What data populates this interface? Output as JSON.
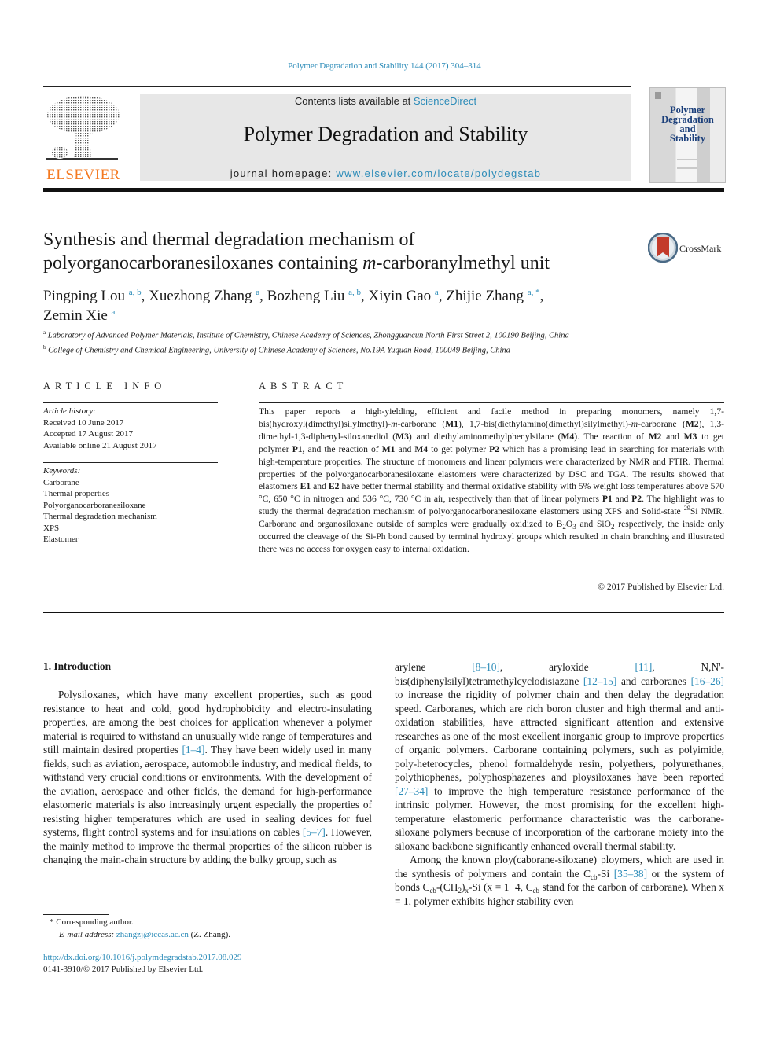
{
  "journal_citation": "Polymer Degradation and Stability 144 (2017) 304–314",
  "header": {
    "publisher_logo_text": "ELSEVIER",
    "contents_prefix": "Contents lists available at ",
    "contents_link": "ScienceDirect",
    "journal_title": "Polymer Degradation and Stability",
    "homepage_prefix": "journal homepage: ",
    "homepage_link": "www.elsevier.com/locate/polydegstab",
    "cover_title_lines": [
      "Polymer",
      "Degradation",
      "and",
      "Stability"
    ],
    "crossmark_label": "CrossMark"
  },
  "article": {
    "title_line1": "Synthesis and thermal degradation mechanism of",
    "title_line2_pre": "polyorganocarboranesiloxanes containing ",
    "title_line2_ital": "m",
    "title_line2_post": "-carboranylmethyl unit",
    "authors": [
      {
        "name": "Pingping Lou",
        "aff": "a, b"
      },
      {
        "name": "Xuezhong Zhang",
        "aff": "a"
      },
      {
        "name": "Bozheng Liu",
        "aff": "a, b"
      },
      {
        "name": "Xiyin Gao",
        "aff": "a"
      },
      {
        "name": "Zhijie Zhang",
        "aff": "a, *"
      },
      {
        "name": "Zemin Xie",
        "aff": "a"
      }
    ],
    "affiliations": [
      {
        "key": "a",
        "text": "Laboratory of Advanced Polymer Materials, Institute of Chemistry, Chinese Academy of Sciences, Zhongguancun North First Street 2, 100190 Beijing, China"
      },
      {
        "key": "b",
        "text": "College of Chemistry and Chemical Engineering, University of Chinese Academy of Sciences, No.19A Yuquan Road, 100049 Beijing, China"
      }
    ]
  },
  "article_info": {
    "heading": "ARTICLE INFO",
    "history_label": "Article history:",
    "history": [
      "Received 10 June 2017",
      "Accepted 17 August 2017",
      "Available online 21 August 2017"
    ],
    "keywords_label": "Keywords:",
    "keywords": [
      "Carborane",
      "Thermal properties",
      "Polyorganocarboranesiloxane",
      "Thermal degradation mechanism",
      "XPS",
      "Elastomer"
    ]
  },
  "abstract": {
    "heading": "ABSTRACT",
    "t1": "This paper reports a high-yielding, efficient and facile method in preparing monomers, namely 1,7-bis(hydroxyl(dimethyl)silylmethyl)-",
    "m": "m",
    "t2": "-carborane (",
    "M1": "M1",
    "t3": "), 1,7-bis(diethylamino(dimethyl)silylmethyl)-",
    "t4": "-carborane (",
    "M2": "M2",
    "t5": "), 1,3-dimethyl-1,3-diphenyl-siloxanediol (",
    "M3": "M3",
    "t6": ") and diethylaminomethylphenylsilane (",
    "M4": "M4",
    "t7": "). The reaction of ",
    "t8": " and ",
    "t9": " to get polymer ",
    "P1c": "P1,",
    "t10": " and the reaction of ",
    "t11": " and ",
    "t12": " to get polymer ",
    "P2": "P2",
    "t13": " which has a promising lead in searching for materials with high-temperature properties. The structure of monomers and linear polymers were characterized by NMR and FTIR. Thermal properties of the polyorganocarboranesiloxane elastomers were characterized by DSC and TGA. The results showed that elastomers ",
    "E1": "E1",
    "t14": " and ",
    "E2": "E2",
    "t15": " have better thermal stability and thermal oxidative stability with 5% weight loss temperatures above 570 °C, 650 °C in nitrogen and 536 °C, 730 °C in air, respectively than that of linear polymers ",
    "P1": "P1",
    "t16": " and ",
    "t17": ". The highlight was to study the thermal degradation mechanism of polyorganocarboranesiloxane elastomers using XPS and Solid-state ",
    "sup29": "29",
    "t18": "Si NMR. Carborane and organosiloxane outside of samples were gradually oxidized to B",
    "sub2a": "2",
    "t19": "O",
    "sub3": "3",
    "t20": " and SiO",
    "sub2b": "2",
    "t21": " respectively, the inside only occurred the cleavage of the Si-Ph bond caused by terminal hydroxyl groups which resulted in chain branching and illustrated there was no access for oxygen easy to internal oxidation.",
    "copyright": "© 2017 Published by Elsevier Ltd."
  },
  "body": {
    "section_heading": "1.  Introduction",
    "left": {
      "a": "Polysiloxanes, which have many excellent properties, such as good resistance to heat and cold, good hydrophobicity and electro-insulating properties, are among the best choices for application whenever a polymer material is required to withstand an unusually wide range of temperatures and still maintain desired properties ",
      "ref1": "[1–4]",
      "b": ". They have been widely used in many fields, such as aviation, aerospace, automobile industry, and medical fields, to withstand very crucial conditions or environments. With the development of the aviation, aerospace and other fields, the demand for high-performance elastomeric materials is also increasingly urgent especially the properties of resisting higher temperatures which are used in sealing devices for fuel systems, flight control systems and for insulations on cables ",
      "ref2": "[5–7]",
      "c": ". However, the mainly method to improve the thermal properties of the silicon rubber is changing the main-chain structure by adding the bulky group, such as"
    },
    "right": {
      "a": "arylene ",
      "ref1": "[8–10]",
      "b": ", aryloxide ",
      "ref2": "[11]",
      "c": ", N,N'-bis(diphenylsilyl)tetramethylcyclodisiazane ",
      "ref3": "[12–15]",
      "d": " and carboranes ",
      "ref4": "[16–26]",
      "e": " to increase the rigidity of polymer chain and then delay the degradation speed. Carboranes, which are rich boron cluster and high thermal and anti-oxidation stabilities, have attracted significant attention and extensive researches as one of the most excellent inorganic group to improve properties of organic polymers. Carborane containing polymers, such as polyimide, poly-heterocycles, phenol formaldehyde resin, polyethers, polyurethanes, polythiophenes, polyphosphazenes and ploysiloxanes have been reported ",
      "ref5": "[27–34]",
      "f": " to improve the high temperature resistance performance of the intrinsic polymer. However, the most promising for the excellent high-temperature elastomeric performance characteristic was the carborane-siloxane polymers because of incorporation of the carborane moiety into the siloxane backbone significantly enhanced overall thermal stability.",
      "g": "Among the known ploy(caborane-siloxane) ploymers, which are used in the synthesis of polymers and contain the C",
      "cb": "cb",
      "h": "-Si ",
      "ref6": "[35–38]",
      "i": " or the system of bonds C",
      "j": "-(CH",
      "sub2": "2",
      "k": ")",
      "subx": "x",
      "l": "-Si (x = 1−4, C",
      "m": " stand for the carbon of carborane). When x = 1, polymer exhibits higher stability even"
    }
  },
  "footnotes": {
    "corresponding": "* Corresponding author.",
    "email_label": "E-mail address: ",
    "email": "zhangzj@iccas.ac.cn",
    "email_suffix": " (Z. Zhang).",
    "doi": "http://dx.doi.org/10.1016/j.polymdegradstab.2017.08.029",
    "issn": "0141-3910/© 2017 Published by Elsevier Ltd."
  }
}
